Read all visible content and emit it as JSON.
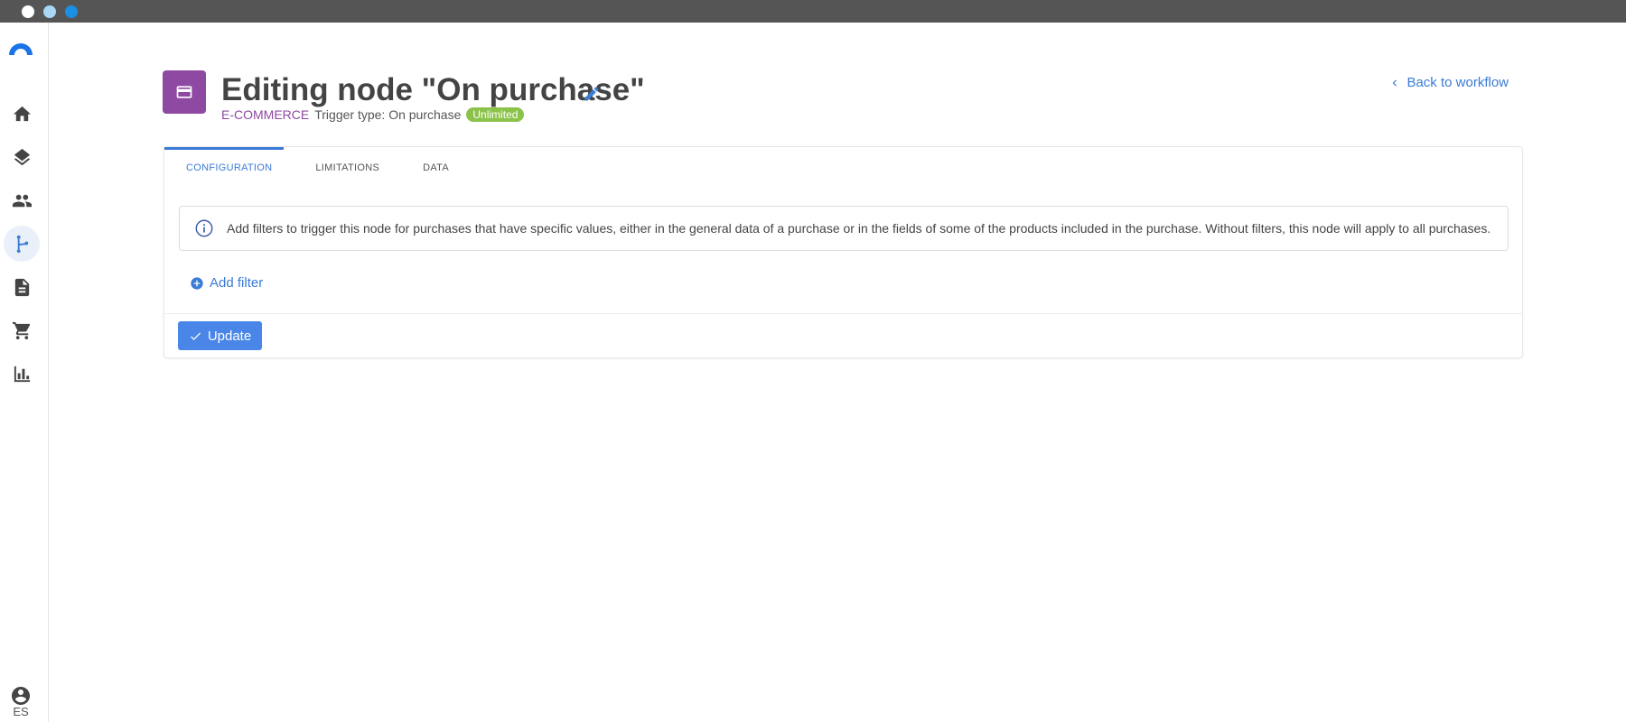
{
  "window": {
    "dot_colors": [
      "#ffffff",
      "#a8d8f5",
      "#1a8fe3"
    ]
  },
  "sidebar": {
    "items": [
      {
        "icon": "home-icon"
      },
      {
        "icon": "layers-icon"
      },
      {
        "icon": "people-icon"
      },
      {
        "icon": "workflow-icon",
        "active": true
      },
      {
        "icon": "document-icon"
      },
      {
        "icon": "cart-icon"
      },
      {
        "icon": "bar-chart-icon"
      }
    ],
    "language": "ES"
  },
  "header": {
    "title": "Editing node \"On purchase\"",
    "category": "E-COMMERCE",
    "trigger_type": "Trigger type: On purchase",
    "badge": "Unlimited",
    "back_label": "Back to workflow",
    "accent_color": "#8e4aa3"
  },
  "tabs": [
    {
      "label": "CONFIGURATION",
      "active": true
    },
    {
      "label": "LIMITATIONS"
    },
    {
      "label": "DATA"
    }
  ],
  "config": {
    "info": "Add filters to trigger this node for purchases that have specific values, either in the general data of a purchase or in the fields of some of the products included in the purchase. Without filters, this node will apply to all purchases.",
    "add_filter_label": "Add filter",
    "update_label": "Update"
  }
}
